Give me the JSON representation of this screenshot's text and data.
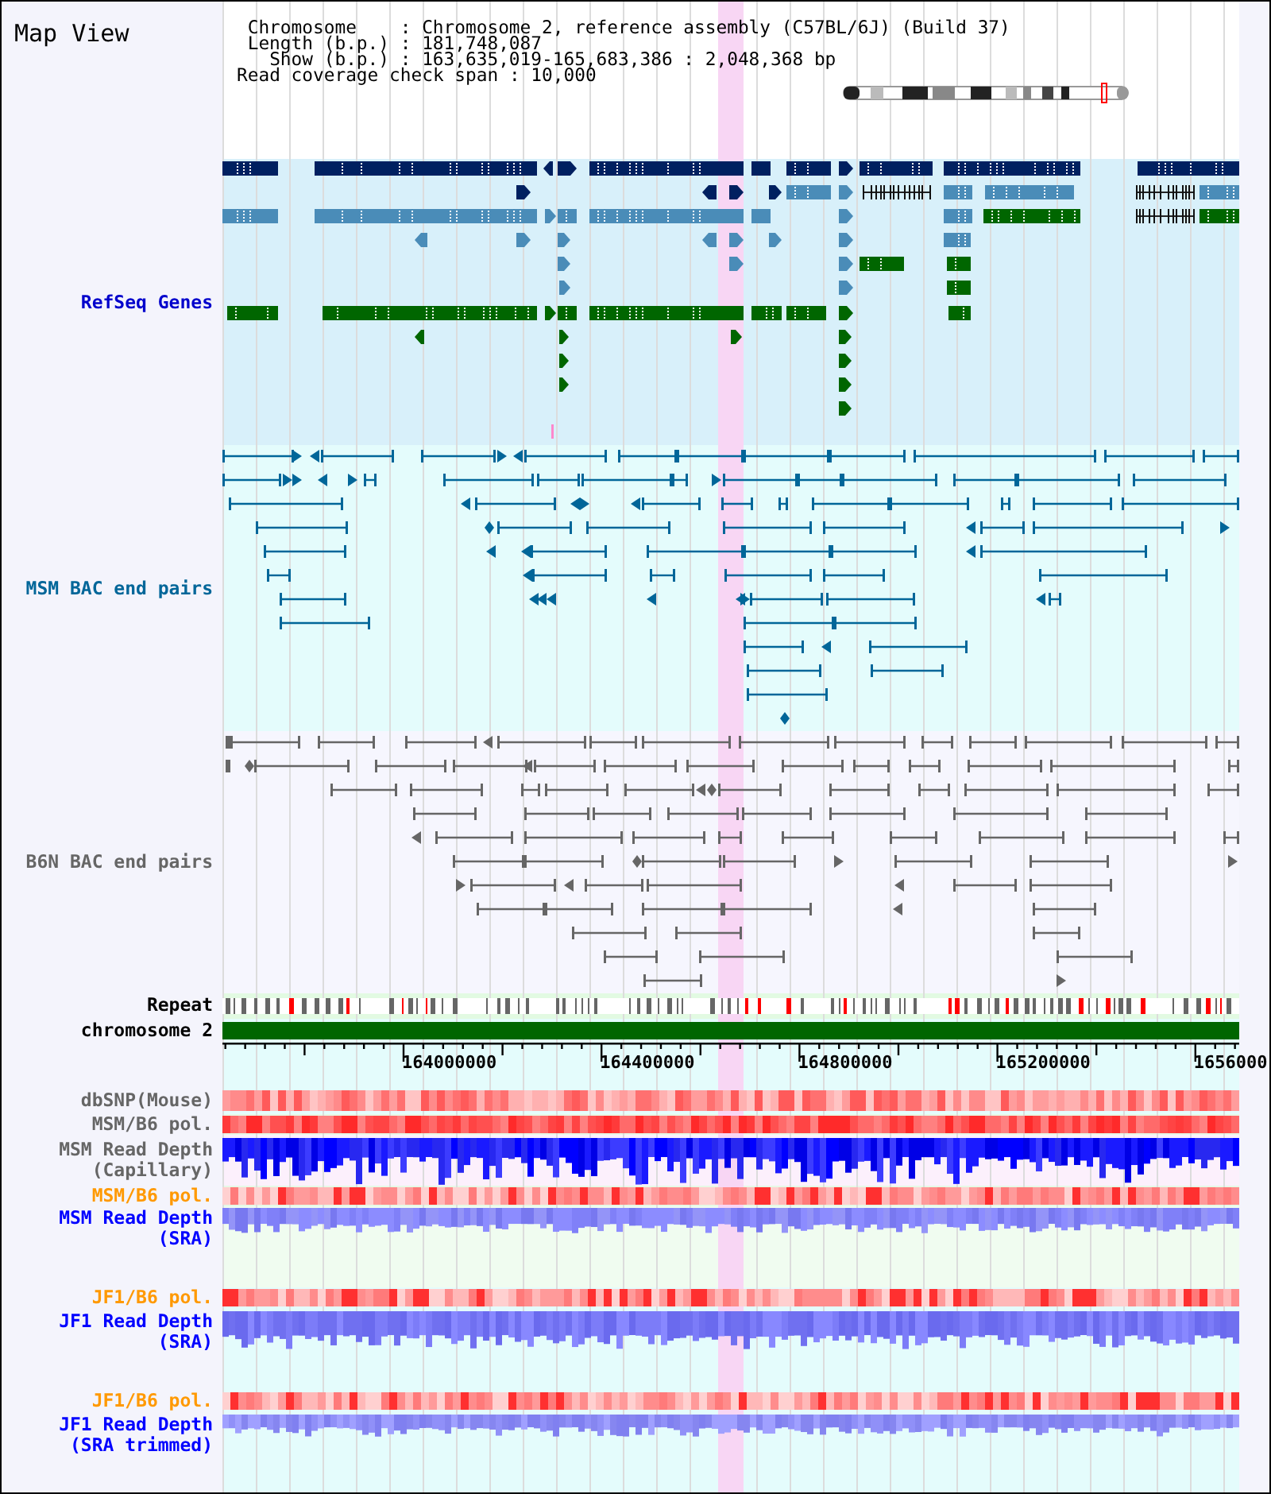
{
  "title": "Map View",
  "info_lines": [
    "Chromosome    : Chromosome 2, reference assembly (C57BL/6J) (Build 37)",
    "Length (b.p.) : 181,748,087",
    "Show (b.p.) : 163,635,019-165,683,386 : 2,048,368 bp",
    "Read coverage check span : 10,000"
  ],
  "tracks": [
    {
      "kind": "genes",
      "label_lines": [
        "RefSeq Genes"
      ],
      "color": "#0000cc"
    },
    {
      "kind": "bac_pairs",
      "label_lines": [
        "MSM BAC end pairs"
      ],
      "color": "#006699"
    },
    {
      "kind": "bac_pairs",
      "label_lines": [
        "B6N BAC end pairs"
      ],
      "color": "#666666"
    },
    {
      "kind": "repeat",
      "label_lines": [
        "Repeat"
      ],
      "color": "#000000"
    },
    {
      "kind": "chromosome",
      "label_lines": [
        "chromosome 2"
      ],
      "color": "#000000"
    },
    {
      "kind": "axis",
      "tick_labels": [
        "164000000",
        "164400000",
        "164800000",
        "165200000",
        "1656000"
      ]
    },
    {
      "kind": "snp",
      "label_lines": [
        "dbSNP(Mouse)"
      ],
      "color": "#666666"
    },
    {
      "kind": "polymorphism",
      "label_lines": [
        "MSM/B6 pol."
      ],
      "color": "#666666"
    },
    {
      "kind": "read_depth",
      "label_lines": [
        "MSM Read Depth",
        "(Capillary)"
      ],
      "color": "#666666"
    },
    {
      "kind": "polymorphism",
      "label_lines": [
        "MSM/B6 pol."
      ],
      "color": "#ff9900"
    },
    {
      "kind": "read_depth",
      "label_lines": [
        "MSM Read Depth",
        "(SRA)"
      ],
      "color": "#0000ff"
    },
    {
      "kind": "polymorphism",
      "label_lines": [
        "JF1/B6 pol."
      ],
      "color": "#ff9900"
    },
    {
      "kind": "read_depth",
      "label_lines": [
        "JF1 Read Depth",
        "(SRA)"
      ],
      "color": "#0000ff"
    },
    {
      "kind": "polymorphism",
      "label_lines": [
        "JF1/B6 pol."
      ],
      "color": "#ff9900"
    },
    {
      "kind": "read_depth",
      "label_lines": [
        "JF1 Read Depth",
        "(SRA trimmed)"
      ],
      "color": "#0000ff"
    }
  ]
}
